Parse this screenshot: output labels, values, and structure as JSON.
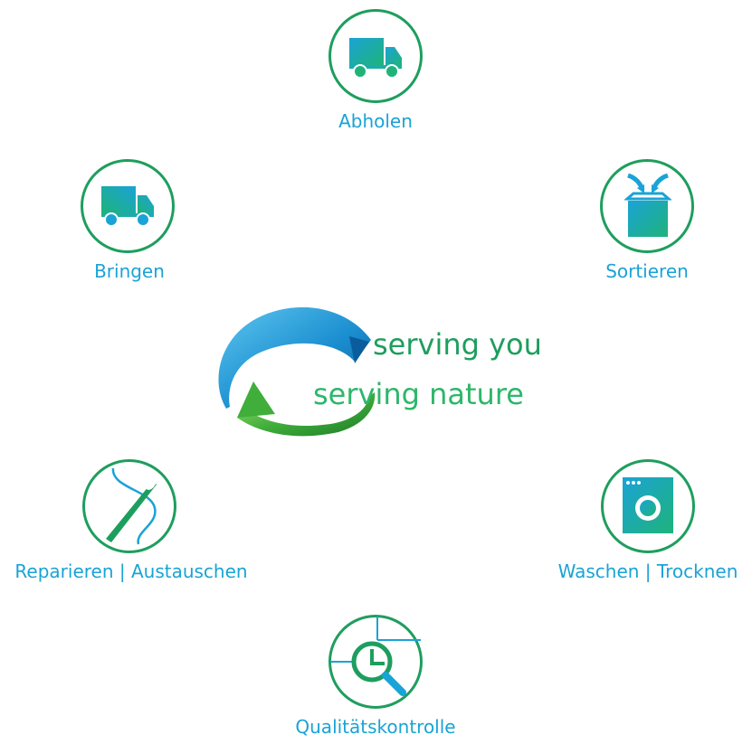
{
  "steps": {
    "abholen": "Abholen",
    "sortieren": "Sortieren",
    "waschen": "Waschen | Trocknen",
    "qualitaet": "Qualitätskontrolle",
    "reparieren": "Reparieren | Austauschen",
    "bringen": "Bringen"
  },
  "tagline": {
    "line1": "serving you",
    "line2": "serving  nature"
  },
  "icons": [
    "truck-icon",
    "box-arrows-icon",
    "washing-machine-icon",
    "magnifier-chart-icon",
    "needle-thread-icon",
    "truck-icon"
  ],
  "colors": {
    "ring": "#1e9e5e",
    "label": "#1aa3d6",
    "blue": "#1aa3d6",
    "green": "#2db76a"
  }
}
